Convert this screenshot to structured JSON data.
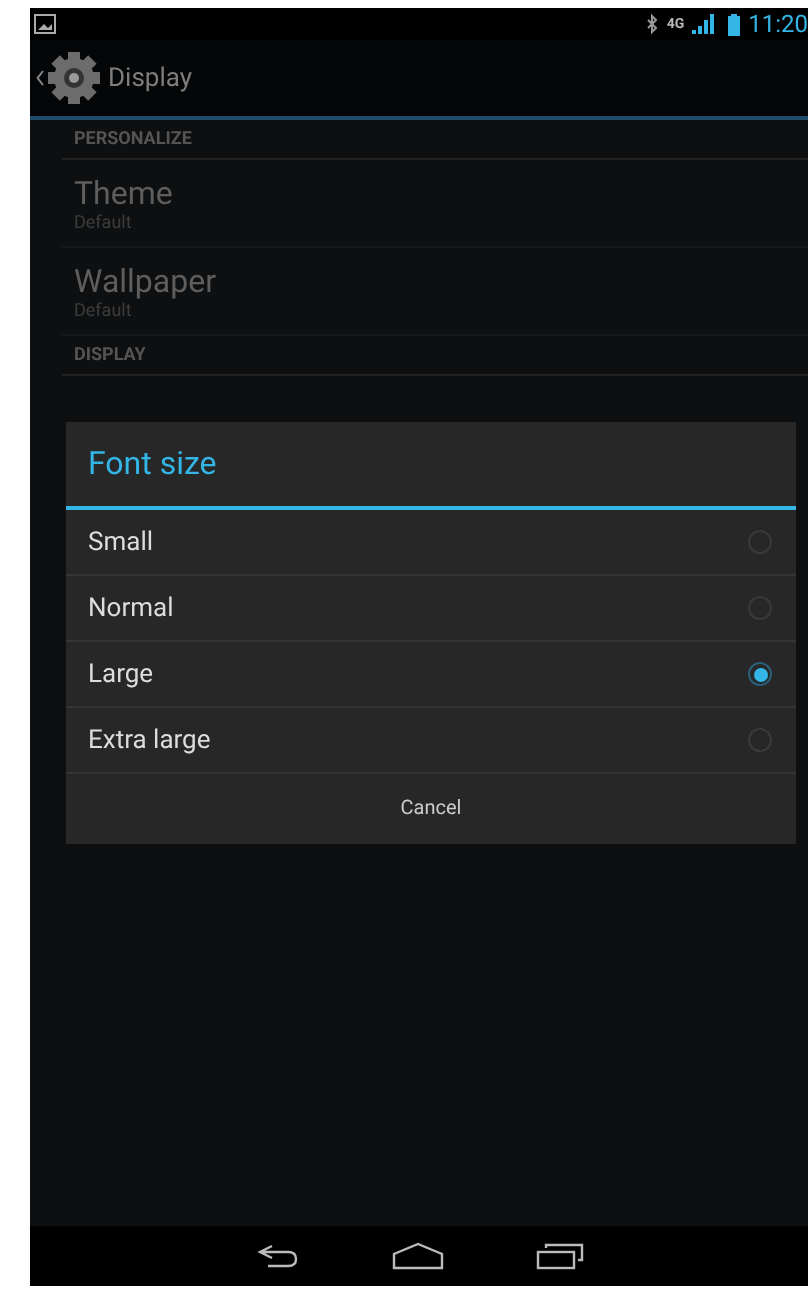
{
  "status_bar": {
    "network": "4G",
    "time": "11:20"
  },
  "action_bar": {
    "title": "Display"
  },
  "settings": [
    {
      "kind": "header",
      "title": "PERSONALIZE"
    },
    {
      "kind": "item",
      "title": "Theme",
      "summary": "Default"
    },
    {
      "kind": "item",
      "title": "Wallpaper",
      "summary": "Default"
    },
    {
      "kind": "header",
      "title": "DISPLAY"
    }
  ],
  "dialog": {
    "title": "Font size",
    "options": [
      {
        "label": "Small",
        "selected": false
      },
      {
        "label": "Normal",
        "selected": false
      },
      {
        "label": "Large",
        "selected": true
      },
      {
        "label": "Extra large",
        "selected": false
      }
    ],
    "cancel": "Cancel"
  }
}
